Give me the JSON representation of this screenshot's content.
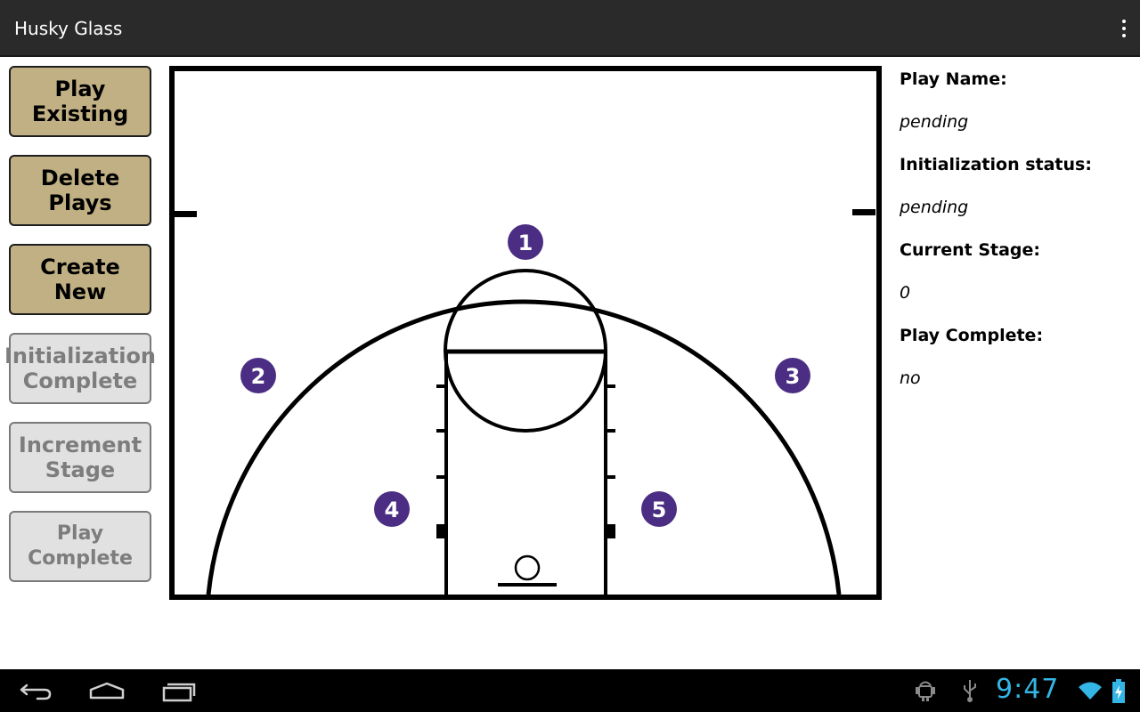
{
  "app": {
    "title": "Husky Glass"
  },
  "buttons": {
    "play_existing": "Play Existing",
    "delete_plays": "Delete Plays",
    "create_new": "Create New",
    "initialization_complete": "Initialization Complete",
    "increment_stage": "Increment Stage",
    "play_complete": "Play Complete"
  },
  "court": {
    "player_markers": [
      "1",
      "2",
      "3",
      "4",
      "5"
    ],
    "marker_color": "#4b2e83"
  },
  "info_panel": {
    "play_name_label": "Play Name:",
    "play_name_value": "pending",
    "init_status_label": "Initialization status:",
    "init_status_value": "pending",
    "current_stage_label": "Current Stage:",
    "current_stage_value": "0",
    "play_complete_label": "Play Complete:",
    "play_complete_value": "no"
  },
  "system_bar": {
    "clock": "9:47",
    "nav_icons": [
      "back-icon",
      "home-icon",
      "recent-apps-icon"
    ],
    "status_icons": [
      "android-debug-icon",
      "usb-icon",
      "wifi-icon",
      "battery-charging-icon"
    ],
    "accent": "#33b5e5"
  },
  "colors": {
    "action_bar": "#2a2a2a",
    "button_enabled": "#c1b083",
    "button_disabled": "#e1e1e1"
  }
}
